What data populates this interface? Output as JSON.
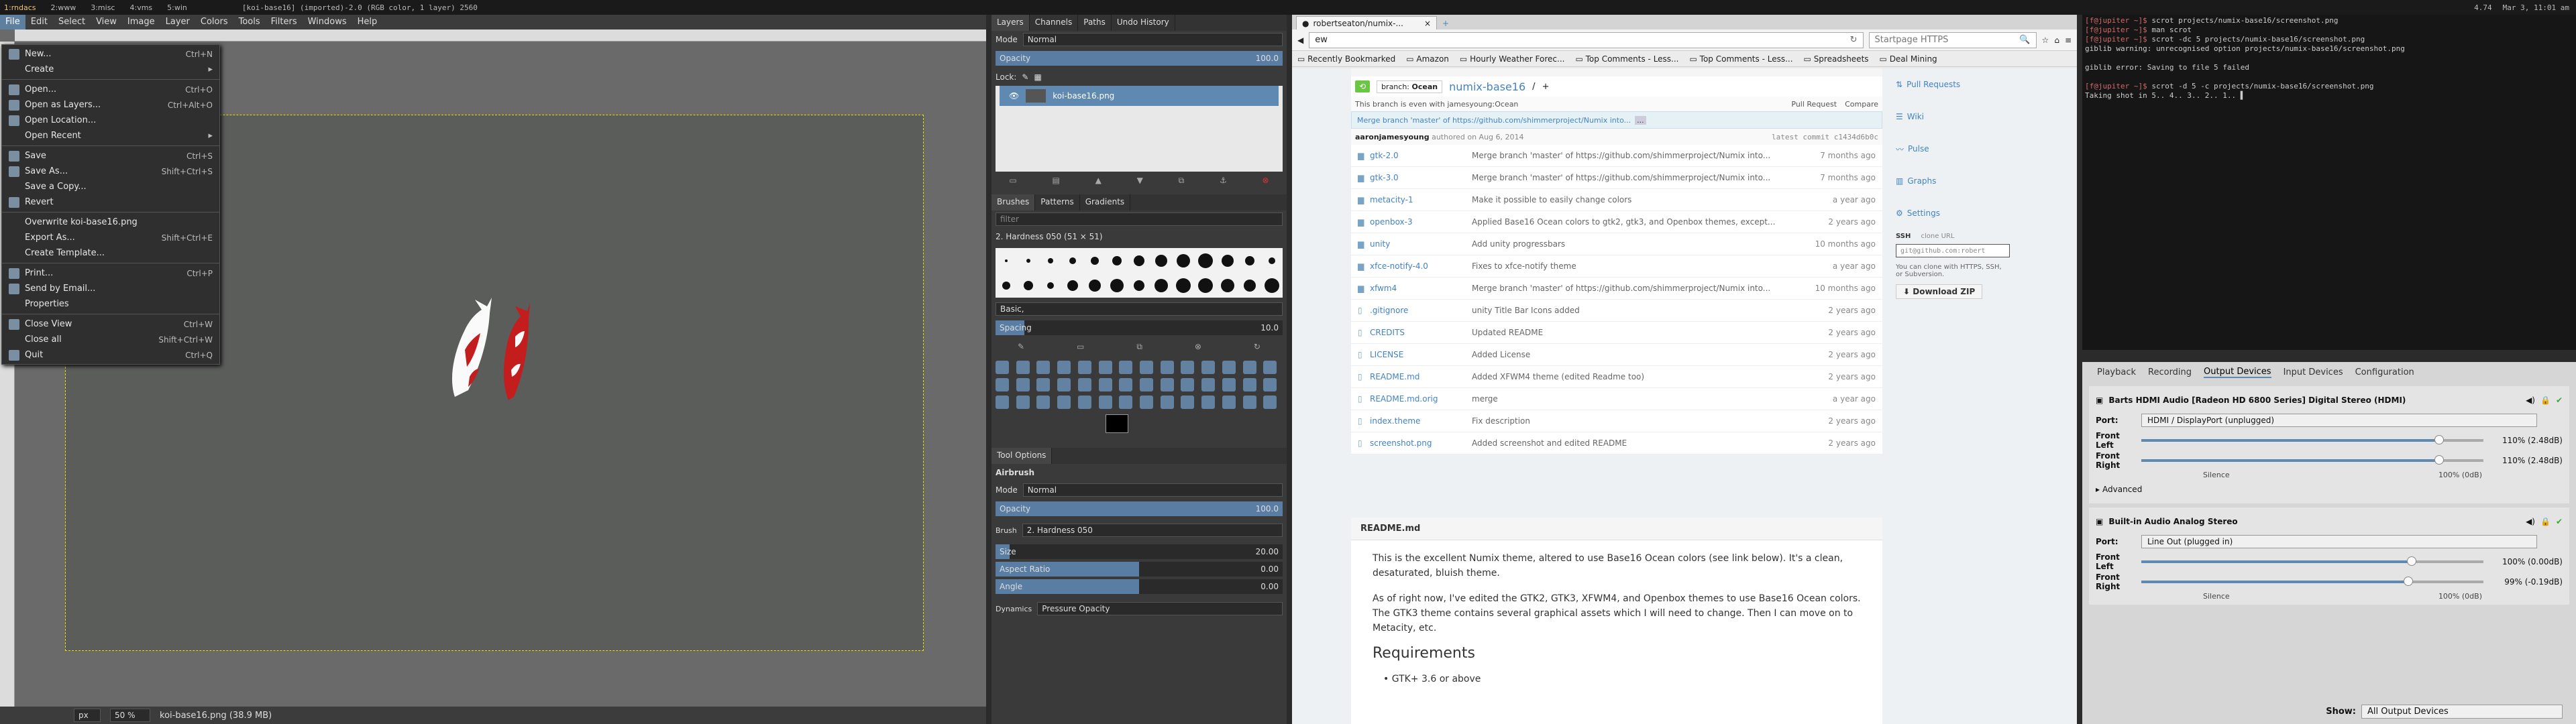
{
  "wm": {
    "workspaces": [
      "1:rndacs",
      "2:www",
      "3:misc",
      "4:vms",
      "5:win"
    ],
    "status": "[koi-base16] (imported)-2.0 (RGB color, 1 layer) 2560",
    "right": [
      "4.74",
      "Mar 3, 11:01 am"
    ]
  },
  "gimp": {
    "menu": [
      "File",
      "Edit",
      "Select",
      "View",
      "Image",
      "Layer",
      "Colors",
      "Tools",
      "Filters",
      "Windows",
      "Help"
    ],
    "file_menu": [
      {
        "label": "New...",
        "shortcut": "Ctrl+N",
        "icon": "new-icon"
      },
      {
        "label": "Create",
        "shortcut": "",
        "sub": true
      },
      {
        "sep": true
      },
      {
        "label": "Open...",
        "shortcut": "Ctrl+O",
        "icon": "open-icon"
      },
      {
        "label": "Open as Layers...",
        "shortcut": "Ctrl+Alt+O",
        "icon": "open-layers-icon"
      },
      {
        "label": "Open Location...",
        "shortcut": "",
        "icon": "location-icon"
      },
      {
        "label": "Open Recent",
        "shortcut": "",
        "sub": true
      },
      {
        "sep": true
      },
      {
        "label": "Save",
        "shortcut": "Ctrl+S",
        "icon": "save-icon"
      },
      {
        "label": "Save As...",
        "shortcut": "Shift+Ctrl+S",
        "icon": "save-as-icon"
      },
      {
        "label": "Save a Copy...",
        "shortcut": ""
      },
      {
        "label": "Revert",
        "shortcut": "",
        "icon": "revert-icon"
      },
      {
        "sep": true
      },
      {
        "label": "Overwrite koi-base16.png",
        "shortcut": ""
      },
      {
        "label": "Export As...",
        "shortcut": "Shift+Ctrl+E"
      },
      {
        "label": "Create Template...",
        "shortcut": ""
      },
      {
        "sep": true
      },
      {
        "label": "Print...",
        "shortcut": "Ctrl+P",
        "icon": "print-icon"
      },
      {
        "label": "Send by Email...",
        "shortcut": "",
        "icon": "mail-icon"
      },
      {
        "label": "Properties",
        "shortcut": ""
      },
      {
        "sep": true
      },
      {
        "label": "Close View",
        "shortcut": "Ctrl+W",
        "icon": "close-view-icon"
      },
      {
        "label": "Close all",
        "shortcut": "Shift+Ctrl+W"
      },
      {
        "label": "Quit",
        "shortcut": "Ctrl+Q",
        "icon": "quit-icon"
      }
    ],
    "status": {
      "unit": "px",
      "zoom": "50 %",
      "file": "koi-base16.png (38.9 MB)"
    }
  },
  "dock": {
    "layer_tabs": [
      "Layers",
      "Channels",
      "Paths",
      "Undo History"
    ],
    "mode_label": "Mode",
    "mode_value": "Normal",
    "opacity_label": "Opacity",
    "opacity_value": "100.0",
    "lock_label": "Lock:",
    "layer_name": "koi-base16.png",
    "brush_tabs": [
      "Brushes",
      "Patterns",
      "Gradients"
    ],
    "filter_placeholder": "filter",
    "brush_name": "2. Hardness 050 (51 × 51)",
    "brush_tag": "Basic,",
    "spacing_label": "Spacing",
    "spacing_value": "10.0",
    "tool_options_title": "Tool Options",
    "tool_name": "Airbrush",
    "to_mode_label": "Mode",
    "to_mode_value": "Normal",
    "to_opacity_label": "Opacity",
    "to_opacity_value": "100.0",
    "brush_label": "Brush",
    "brush_value": "2. Hardness 050",
    "size_label": "Size",
    "size_value": "20.00",
    "aspect_label": "Aspect Ratio",
    "aspect_value": "0.00",
    "angle_label": "Angle",
    "angle_value": "0.00",
    "dynamics_label": "Dynamics",
    "dynamics_value": "Pressure Opacity"
  },
  "browser": {
    "tab_title": "robertseaton/numix-...",
    "url": "ew",
    "search_placeholder": "Startpage HTTPS",
    "bookmarks": [
      "Recently Bookmarked",
      "Amazon",
      "Hourly Weather Forec...",
      "Top Comments - Less...",
      "Top Comments - Less...",
      "Spreadsheets",
      "Deal Mining"
    ],
    "branch_label": "branch:",
    "branch": "Ocean",
    "repo": "numix-base16",
    "repo_sep": "/",
    "plus": "+",
    "even_note": "This branch is even with jamesyoung:Ocean",
    "pull_request": "Pull Request",
    "compare": "Compare",
    "commit_msg": "Merge branch 'master' of https://github.com/shimmerproject/Numix into...",
    "commit_ellipsis": "...",
    "author": "aaronjamesyoung",
    "authored": "authored on Aug 6, 2014",
    "latest_commit": "latest commit c1434d6b0c",
    "files": [
      {
        "name": "gtk-2.0",
        "msg": "Merge branch 'master' of https://github.com/shimmerproject/Numix into...",
        "age": "7 months ago",
        "type": "dir"
      },
      {
        "name": "gtk-3.0",
        "msg": "Merge branch 'master' of https://github.com/shimmerproject/Numix into...",
        "age": "7 months ago",
        "type": "dir"
      },
      {
        "name": "metacity-1",
        "msg": "Make it possible to easily change colors",
        "age": "a year ago",
        "type": "dir"
      },
      {
        "name": "openbox-3",
        "msg": "Applied Base16 Ocean colors to gtk2, gtk3, and Openbox themes, except...",
        "age": "2 years ago",
        "type": "dir"
      },
      {
        "name": "unity",
        "msg": "Add unity progressbars",
        "age": "10 months ago",
        "type": "dir"
      },
      {
        "name": "xfce-notify-4.0",
        "msg": "Fixes to xfce-notify theme",
        "age": "a year ago",
        "type": "dir"
      },
      {
        "name": "xfwm4",
        "msg": "Merge branch 'master' of https://github.com/shimmerproject/Numix into...",
        "age": "10 months ago",
        "type": "dir"
      },
      {
        "name": ".gitignore",
        "msg": "unity Title Bar Icons added",
        "age": "2 years ago",
        "type": "file"
      },
      {
        "name": "CREDITS",
        "msg": "Updated README",
        "age": "2 years ago",
        "type": "file"
      },
      {
        "name": "LICENSE",
        "msg": "Added License",
        "age": "2 years ago",
        "type": "file"
      },
      {
        "name": "README.md",
        "msg": "Added XFWM4 theme (edited Readme too)",
        "age": "2 years ago",
        "type": "file"
      },
      {
        "name": "README.md.orig",
        "msg": "merge",
        "age": "a year ago",
        "type": "file"
      },
      {
        "name": "index.theme",
        "msg": "Fix description",
        "age": "2 years ago",
        "type": "file"
      },
      {
        "name": "screenshot.png",
        "msg": "Added screenshot and edited README",
        "age": "2 years ago",
        "type": "file"
      }
    ],
    "readme_header": "README.md",
    "readme_p1": "This is the excellent Numix theme, altered to use Base16 Ocean colors (see link below). It's a clean, desaturated, bluish theme.",
    "readme_p2": "As of right now, I've edited the GTK2, GTK3, XFWM4, and Openbox themes to use Base16 Ocean colors. The GTK3 theme contains several graphical assets which I will need to change. Then I can move on to Metacity, etc.",
    "readme_h2": "Requirements",
    "readme_li": "GTK+ 3.6 or above",
    "sidebar": [
      "Pull Requests",
      "Wiki",
      "Pulse",
      "Graphs",
      "Settings"
    ],
    "ssh_label": "SSH",
    "clone_url": "clone URL",
    "clone_value": "git@github.com:robert",
    "clone_note": "You can clone with HTTPS, SSH, or Subversion.",
    "download": "Download ZIP"
  },
  "terminal": {
    "lines": [
      {
        "p": "[f@jupiter ~]$",
        "c": " scrot projects/numix-base16/screenshot.png"
      },
      {
        "p": "[f@jupiter ~]$",
        "c": " man scrot"
      },
      {
        "p": "[f@jupiter ~]$",
        "c": " scrot -dc 5 projects/numix-base16/screenshot.png"
      },
      {
        "p": "",
        "c": "giblib warning: unrecognised option projects/numix-base16/screenshot.png"
      },
      {
        "p": "",
        "c": ""
      },
      {
        "p": "",
        "c": "giblib error: Saving to file 5 failed"
      },
      {
        "p": "",
        "c": ""
      },
      {
        "p": "[f@jupiter ~]$",
        "c": " scrot -d 5 -c projects/numix-base16/screenshot.png"
      },
      {
        "p": "",
        "c": "Taking shot in 5.. 4.. 3.. 2.. 1.. ▌"
      }
    ]
  },
  "pavu": {
    "tabs": [
      "Playback",
      "Recording",
      "Output Devices",
      "Input Devices",
      "Configuration"
    ],
    "dev1": {
      "name": "Barts HDMI Audio [Radeon HD 6800 Series] Digital Stereo (HDMI)",
      "port": "HDMI / DisplayPort (unplugged)",
      "fl": "110% (2.48dB)",
      "fr": "110% (2.48dB)",
      "fl_val": 0.87,
      "fr_val": 0.87
    },
    "dev2": {
      "name": "Built-in Audio Analog Stereo",
      "port": "Line Out (plugged in)",
      "fl": "100% (0.00dB)",
      "fr": "99% (-0.19dB)",
      "fl_val": 0.79,
      "fr_val": 0.78
    },
    "port_label": "Port:",
    "fl_label": "Front Left",
    "fr_label": "Front Right",
    "silence": "Silence",
    "hundred": "100% (0dB)",
    "advanced": "Advanced",
    "show_label": "Show:",
    "show_value": "All Output Devices"
  }
}
